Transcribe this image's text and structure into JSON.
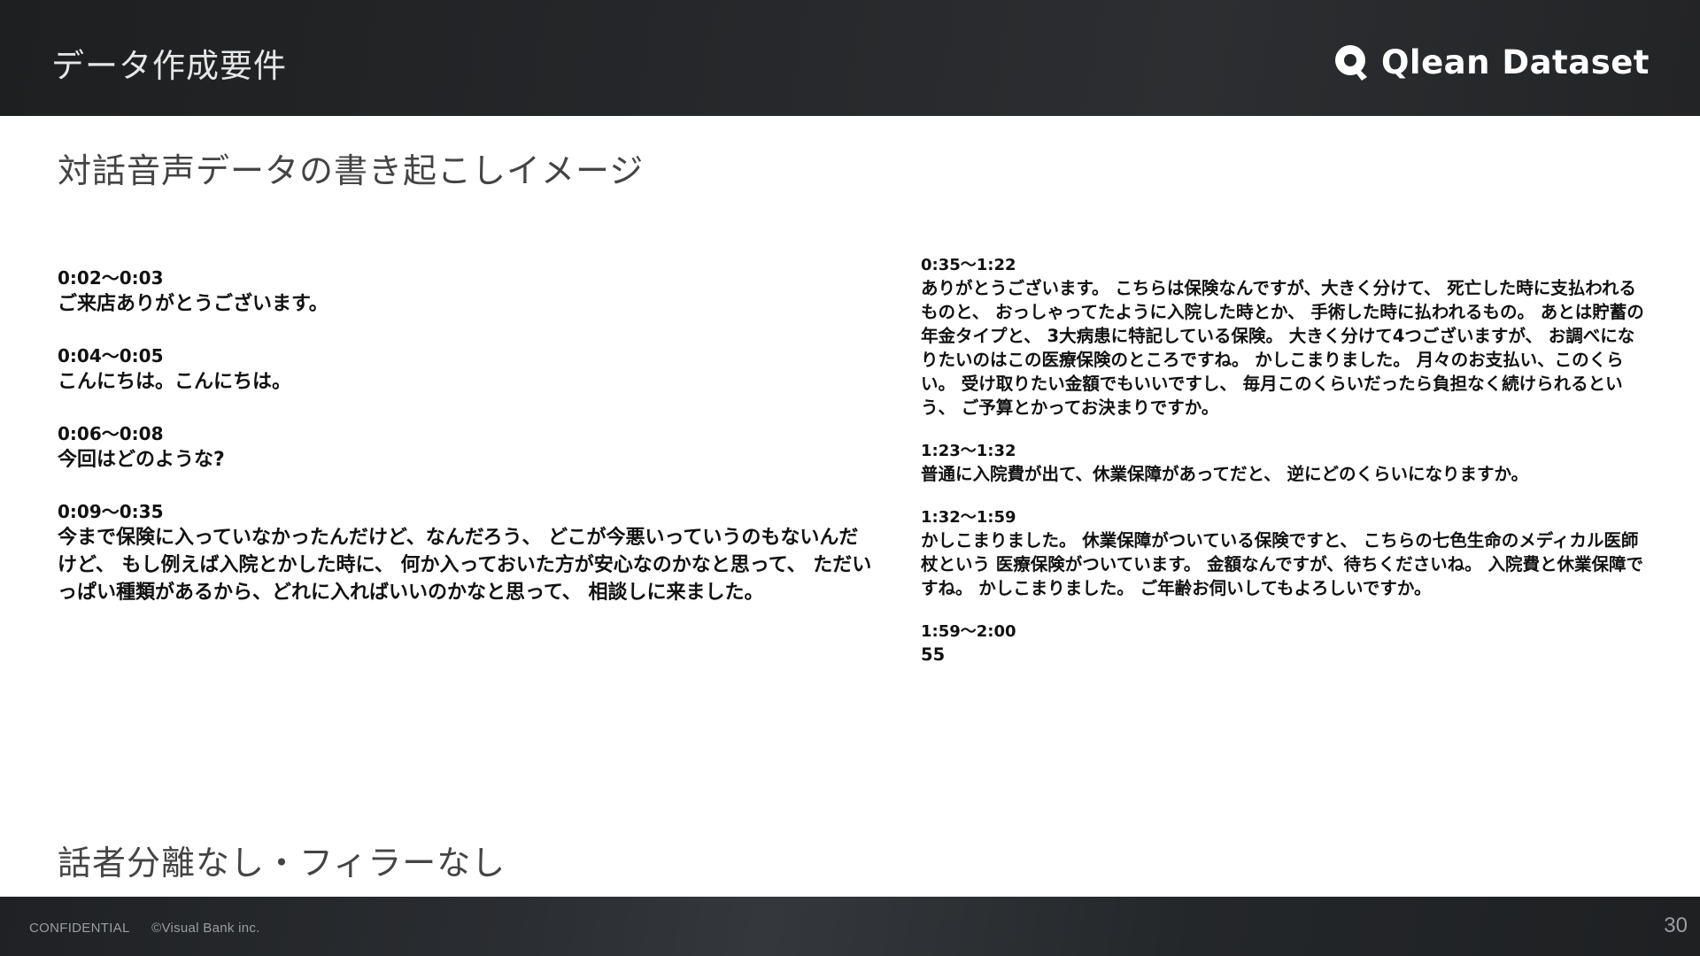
{
  "header": {
    "title": "データ作成要件",
    "logo_text": "Qlean Dataset",
    "logo_icon": "qlean-logo-icon"
  },
  "page_heading": "対話音声データの書き起こしイメージ",
  "transcript_left": [
    {
      "time": "0:02〜0:03",
      "text": "ご来店ありがとうございます。"
    },
    {
      "time": "0:04〜0:05",
      "text": "こんにちは。こんにちは。"
    },
    {
      "time": "0:06〜0:08",
      "text": "今回はどのような?"
    },
    {
      "time": "0:09〜0:35",
      "text": "今まで保険に入っていなかったんだけど、なんだろう、 どこが今悪いっていうのもないんだけど、 もし例えば入院とかした時に、 何か入っておいた方が安心なのかなと思って、 ただいっぱい種類があるから、どれに入ればいいのかなと思って、 相談しに来ました。"
    }
  ],
  "transcript_right": [
    {
      "time": "0:35〜1:22",
      "text": "ありがとうございます。 こちらは保険なんですが、大きく分けて、 死亡した時に支払われるものと、 おっしゃってたように入院した時とか、 手術した時に払われるもの。 あとは貯蓄の年金タイプと、 3大病患に特記している保険。 大きく分けて4つございますが、 お調べになりたいのはこの医療保険のところですね。 かしこまりました。 月々のお支払い、このくらい。 受け取りたい金額でもいいですし、 毎月このくらいだったら負担なく続けられるという、 ご予算とかってお決まりですか。"
    },
    {
      "time": "1:23〜1:32",
      "text": "普通に入院費が出て、休業保障があってだと、 逆にどのくらいになりますか。"
    },
    {
      "time": "1:32〜1:59",
      "text": "かしこまりました。 休業保障がついている保険ですと、 こちらの七色生命のメディカル医師杖という 医療保険がついています。 金額なんですが、待ちくださいね。 入院費と休業保障ですね。 かしこまりました。 ご年齢お伺いしてもよろしいですか。"
    },
    {
      "time": "1:59〜2:00",
      "text": "55"
    }
  ],
  "bottom_note": "話者分離なし・フィラーなし",
  "footer": {
    "confidential": "CONFIDENTIAL",
    "copyright": "©Visual Bank inc.",
    "page_number": "30"
  }
}
